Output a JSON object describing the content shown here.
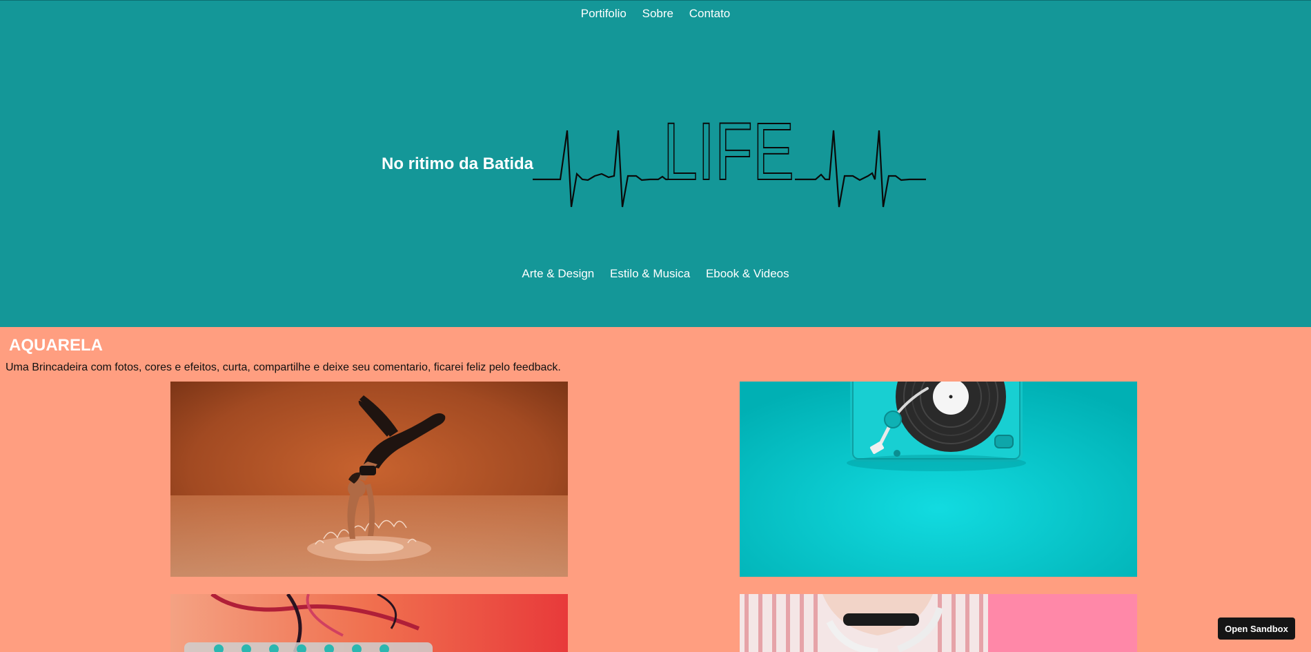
{
  "top_nav": {
    "items": [
      {
        "label": "Portifolio"
      },
      {
        "label": "Sobre"
      },
      {
        "label": "Contato"
      }
    ]
  },
  "hero": {
    "tagline": "No ritimo da Batida",
    "logo_text": "LIFE",
    "background_color": "#149798"
  },
  "sub_nav": {
    "items": [
      {
        "label": "Arte & Design"
      },
      {
        "label": "Estilo & Musica"
      },
      {
        "label": "Ebook & Videos"
      }
    ]
  },
  "section": {
    "title": "AQUARELA",
    "description": "Uma Brincadeira com fotos, cores e efeitos, curta, compartilhe e deixe seu comentario, ficarei feliz pelo feedback.",
    "background_color": "#ff9e80"
  },
  "gallery": {
    "photos": [
      {
        "subject": "handstand-dancer-water-splash"
      },
      {
        "subject": "turntable-on-teal"
      },
      {
        "subject": "cassette-tape-on-red"
      },
      {
        "subject": "person-with-headphones-on-pink"
      }
    ]
  },
  "sandbox_button": {
    "label": "Open Sandbox"
  }
}
